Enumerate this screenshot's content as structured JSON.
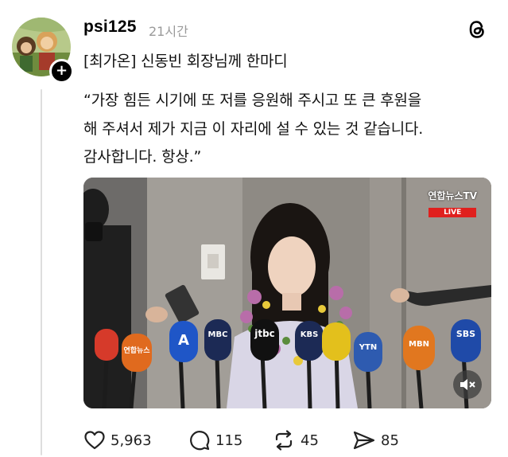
{
  "post": {
    "username": "psi125",
    "timestamp": "21시간",
    "headline": "[최가온] 신동빈 회장님께 한마디",
    "quote_lines": [
      "“가장 힘든 시기에 또 저를 응원해 주시고 또 큰 후원을",
      "해 주셔서 제가 지금 이 자리에 설 수 있는 것 같습니다.",
      "감사합니다. 항상.”"
    ],
    "follow_symbol": "+"
  },
  "media": {
    "broadcaster": "연합뉴스TV",
    "live_label": "LIVE",
    "mic_labels": [
      "연합뉴스TV",
      "A",
      "MBC",
      "jtbc",
      "KBS",
      "YTN",
      "MBN",
      "SBS"
    ]
  },
  "actions": {
    "likes": "5,963",
    "replies": "115",
    "reposts": "45",
    "shares": "85"
  },
  "icons": {
    "like": "heart-icon",
    "reply": "speech-bubble-icon",
    "repost": "repost-icon",
    "share": "paper-plane-icon",
    "app": "threads-logo-icon",
    "mute": "muted-speaker-icon"
  }
}
